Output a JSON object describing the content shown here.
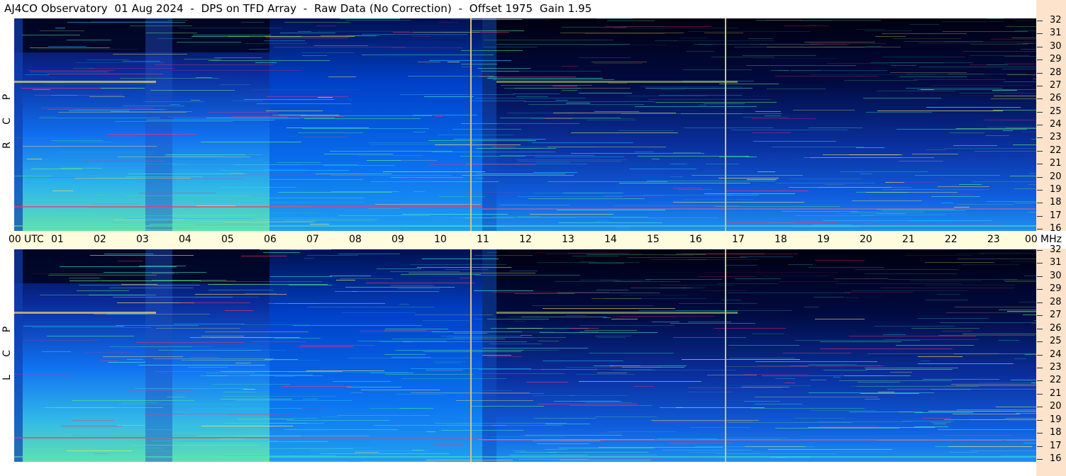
{
  "window": {
    "title": "AJ4CO Observatory  01 Aug 2024  -  DPS on TFD Array  -  Raw Data (No Correction)  -  Offset 1975  Gain 1.95"
  },
  "panels": [
    {
      "id": "rcp",
      "label_letters": [
        "P",
        "C",
        "R"
      ]
    },
    {
      "id": "lcp",
      "label_letters": [
        "P",
        "C",
        "L"
      ]
    }
  ],
  "time_axis": {
    "unit_label": "UTC",
    "freq_unit_label": "MHz",
    "ticks": [
      "00",
      "01",
      "02",
      "03",
      "04",
      "05",
      "06",
      "07",
      "08",
      "09",
      "10",
      "11",
      "12",
      "13",
      "14",
      "15",
      "16",
      "17",
      "18",
      "19",
      "20",
      "21",
      "22",
      "23",
      "00"
    ]
  },
  "freq_scale": {
    "labels": [
      "32",
      "31",
      "30",
      "29",
      "28",
      "27",
      "26",
      "25",
      "24",
      "23",
      "22",
      "21",
      "20",
      "19",
      "18",
      "17",
      "16"
    ]
  },
  "colors": {
    "axis_bar": "#fffbdd",
    "scale_bg": "#fde3cc",
    "marker_line": "#d8c080",
    "spectrum_low": "#000020",
    "spectrum_mid": "#0050e0",
    "spectrum_high": "#40e0a0",
    "spectrum_peak": "#ff2060"
  }
}
